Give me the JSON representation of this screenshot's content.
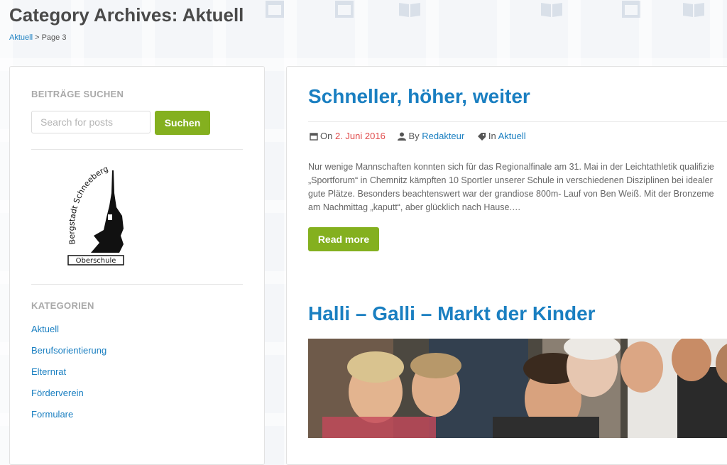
{
  "page": {
    "title": "Category Archives: Aktuell",
    "breadcrumb": {
      "link": "Aktuell",
      "separator": " > ",
      "current": "Page 3"
    }
  },
  "sidebar": {
    "search": {
      "title": "BEITRÄGE SUCHEN",
      "placeholder": "Search for posts",
      "button": "Suchen"
    },
    "logo": {
      "arc_text": "Bergstadt Schneeberg",
      "label": "Oberschule"
    },
    "categories": {
      "title": "KATEGORIEN",
      "items": [
        "Aktuell",
        "Berufsorientierung",
        "Elternrat",
        "Förderverein",
        "Formulare"
      ]
    }
  },
  "posts": [
    {
      "title": "Schneller, höher, weiter",
      "meta": {
        "on_label": "On",
        "date": "2. Juni 2016",
        "by_label": "By",
        "author": "Redakteur",
        "in_label": "In",
        "category": "Aktuell"
      },
      "excerpt": [
        "Nur wenige Mannschaften konnten sich für das Regionalfinale am 31. Mai in der Leichtathletik qualifizie",
        "„Sportforum“ in Chemnitz kämpften 10 Sportler unserer Schule in verschiedenen Disziplinen bei idealer",
        "gute Plätze. Besonders beachtenswert war der grandiose 800m- Lauf von Ben Weiß. Mit der Bronzeme",
        "am Nachmittag „kaputt“, aber glücklich nach Hause.…"
      ],
      "read_more": "Read more"
    },
    {
      "title": "Halli – Galli – Markt der Kinder"
    }
  ],
  "colors": {
    "link": "#1a7fc1",
    "accent_green": "#84b01f",
    "date_red": "#e04b4b"
  },
  "icons": {
    "background": [
      "book-icon",
      "calendar-icon"
    ],
    "meta": [
      "calendar-icon",
      "user-icon",
      "tag-icon"
    ]
  }
}
